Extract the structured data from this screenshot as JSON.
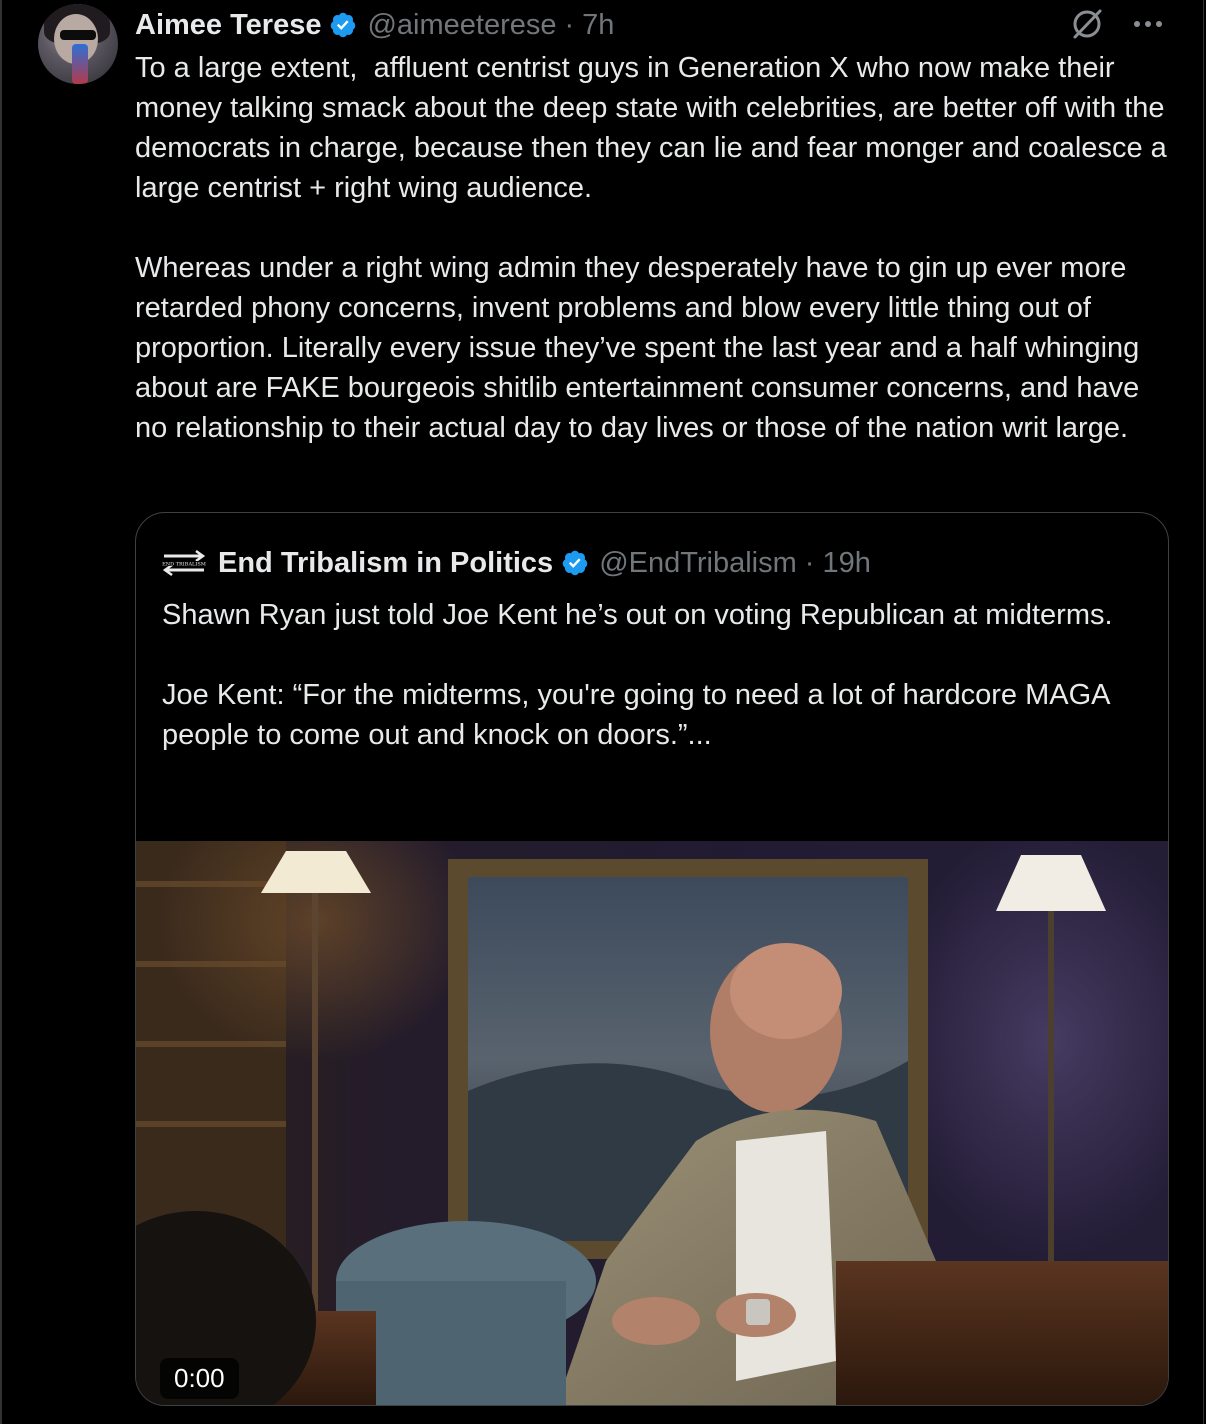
{
  "author": {
    "name": "Aimee Terese",
    "handle": "@aimeeterese",
    "separator": "·",
    "time": "7h"
  },
  "tweet": {
    "text": "To a large extent,  affluent centrist guys in Generation X who now make their money talking smack about the deep state with celebrities, are better off with the democrats in charge, because then they can lie and fear monger and coalesce a large centrist + right wing audience.\n\nWhereas under a right wing admin they desperately have to gin up ever more retarded phony concerns, invent problems and blow every little thing out of proportion. Literally every issue they’ve spent the last year and a half whinging about are FAKE bourgeois shitlib entertainment consumer concerns, and have no relationship to their actual day to day lives or those of the nation writ large."
  },
  "quoted": {
    "name": "End Tribalism in Politics",
    "handle": "@EndTribalism",
    "separator": "·",
    "time": "19h",
    "logo_text": "END TRIBALISM",
    "text": "Shawn Ryan just told Joe Kent he’s out on voting Republican at midterms.\n\nJoe Kent: “For the midterms, you're going to need a lot of hardcore MAGA people to come out and knock on doors.”...",
    "video_time": "0:00"
  },
  "icons": {
    "verified": "verified-badge-icon",
    "grok": "grok-icon",
    "more": "more-options-icon"
  },
  "colors": {
    "background": "#000000",
    "text": "#e7e9ea",
    "secondary": "#71767b",
    "verified": "#1d9bf0",
    "border": "#3e4144"
  }
}
